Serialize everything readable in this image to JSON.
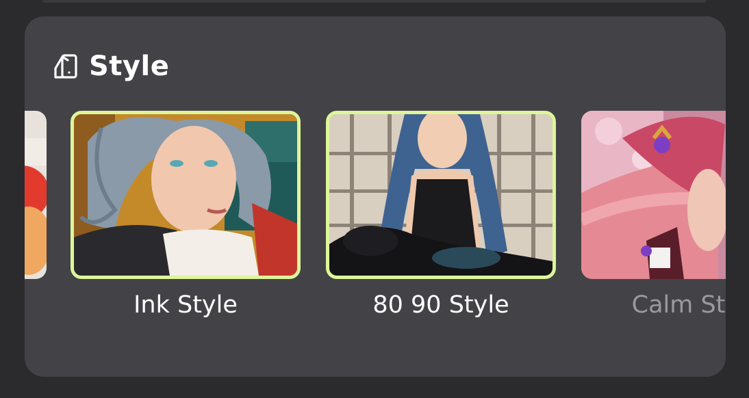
{
  "panel": {
    "title": "Style",
    "icon": "style-palette-icon"
  },
  "styles": [
    {
      "label": "",
      "icon": "partial-thumbnail",
      "selected": false
    },
    {
      "label": "Ink Style",
      "icon": "ink-style-thumbnail",
      "selected": true
    },
    {
      "label": "80 90 Style",
      "icon": "80-90-style-thumbnail",
      "selected": true
    },
    {
      "label": "Calm Style",
      "icon": "calm-style-thumbnail",
      "selected": false
    }
  ],
  "colors": {
    "background": "#2b2b2e",
    "card": "#434347",
    "selected_border": "#def59a",
    "label": "#ffffff",
    "label_dim": "#9a9a9e"
  }
}
